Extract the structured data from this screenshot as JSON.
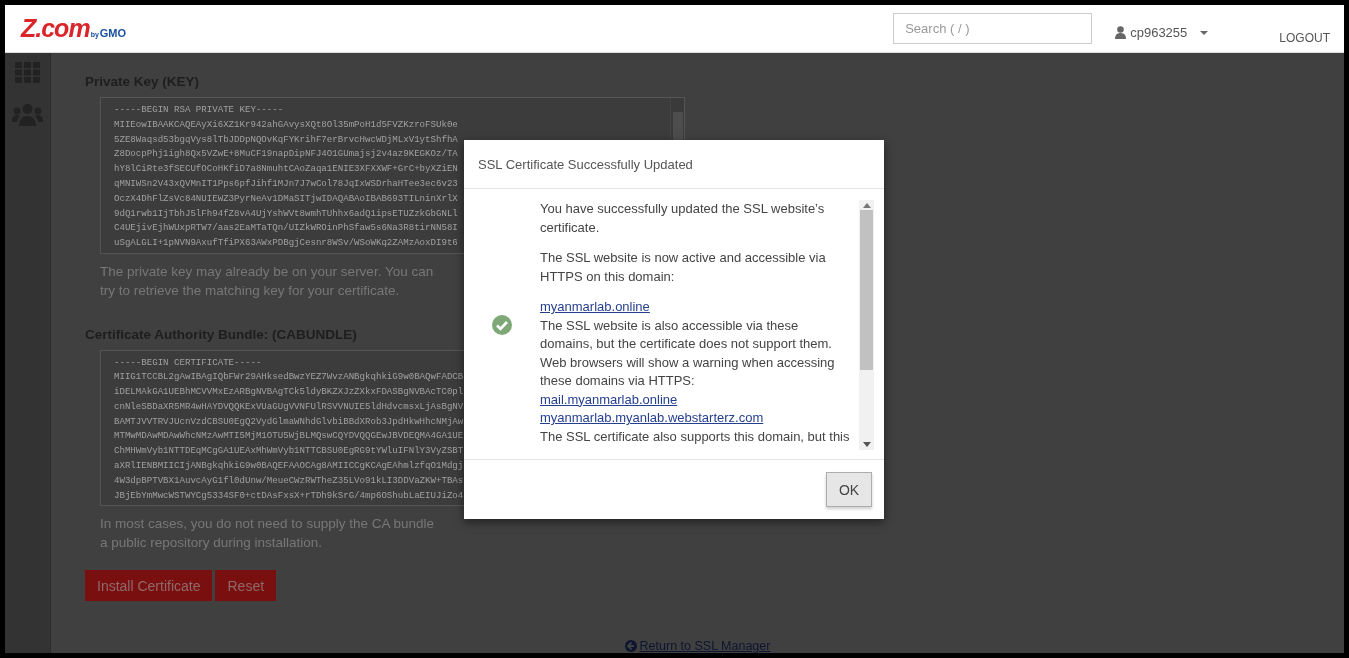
{
  "header": {
    "logo": {
      "brand": "Z.com",
      "by": "by",
      "maker": "GMO"
    },
    "search": {
      "placeholder": "Search ( / )"
    },
    "user": "cp963255",
    "logout": "LOGOUT"
  },
  "sections": [
    {
      "title": "Private Key (KEY)",
      "lines": [
        "-----BEGIN RSA PRIVATE KEY-----",
        "MIIEowIBAAKCAQEAyXi6XZ1Kr942ahGAvysXQt8Ol35mPoH1d5FVZKzroFSUk0e",
        "5ZE8Waqsd53bgqVys8lTbJDDpNQOvKqFYKrihF7erBrvcHwcWDjMLxV1ytShfhA",
        "Z8DocpPhj1igh8Qx5VZwE+8MuCF19napDipNFJ4O1GUmajsj2v4az9KEGKOz/TA",
        "hY8lCiRte3fSECUfOCoHKfiD7a8NmuhtCAoZaqa1ENIE3XFXXWF+GrC+byXZiEN",
        "qMNIWSn2V43xQVMnIT1Pps6pfJihf1MJn7J7wCol78JqIxWSDrhaHTee3ec6v23",
        "OczX4DhFlZsVc84NUIEWZ3PyrNeAv1DMaSITjwIDAQABAoIBAB693TILninXrlX",
        "9dQ1rwb1IjTbhJ5lFh94fZ8vA4UjYshWVt8wmhTUhhx6adQ1ipsETUZzkGbGNLl",
        "C4UEjivEjhWUxpRTW7/aas2EaMTaTQn/UIZkWROinPhSfaw5s6Na3R8tirNN58I",
        "uSgALGLI+1pNVN9AxufTfiPX63AWxPDBgjCesnr8WSv/WSoWKq2ZAMzAoxDI9t6"
      ],
      "help": [
        "The private key may already be on your server. You can",
        "try to retrieve the matching key for your certificate."
      ]
    },
    {
      "title": "Certificate Authority Bundle: (CABUNDLE)",
      "lines": [
        "-----BEGIN CERTIFICATE-----",
        "MIIG1TCCBL2gAwIBAgIQbFWr29AHksedBwzYEZ7WvzANBgkqhkiG9w0BAQwFADCB",
        "iDELMAkGA1UEBhMCVVMxEzARBgNVBAgTCk5ldyBKZXJzZXkxFDASBgNVBAcTC0pl",
        "cnNleSBDaXR5MR4wHAYDVQQKExVUaGUgVVNFUlRSVVNUIE5ldHdvcmsxLjAsBgNV",
        "BAMTJVVTRVJUcnVzdCBSU0EgQ2VydGlmaWNhdGlvbiBBdXRob3JpdHkwHhcNMjAw",
        "MTMwMDAwMDAwWhcNMzAwMTI5MjM1OTU5WjBLMQswCQYDVQQGEwJBVDEQMA4GA1UE",
        "ChMHWmVyb1NTTDEqMCgGA1UEAxMhWmVyb1NTTCBSU0EgRG9tYWluIFNlY3VyZSBT",
        "aXRlIENBMIICIjANBgkqhkiG9w0BAQEFAAOCAg8AMIICCgKCAgEAhmlzfqO1Mdgj",
        "4W3dpBPTVBX1AuvcAyG1fl0dUnw/MeueCWzRWTheZ35LVo91kLI3DDVaZKW+TBAs",
        "JBjEbYmMwcWSTWYCg5334SF0+ctDAsFxsX+rTDh9kSrG/4mp6OShubLaEIUJiZo4"
      ],
      "help": [
        "In most cases, you do not need to supply the CA bundle",
        "a public repository during installation."
      ]
    }
  ],
  "buttons": [
    "Install Certificate",
    "Reset"
  ],
  "return_link": "Return to SSL Manager",
  "modal": {
    "title": "SSL Certificate Successfully Updated",
    "items": [
      {
        "kind": "para",
        "text": "You have successfully updated the SSL website’s certificate."
      },
      {
        "kind": "para",
        "text": "The SSL website is now active and accessible via HTTPS on this domain:"
      },
      {
        "kind": "link",
        "text": "myanmarlab.online"
      },
      {
        "kind": "text",
        "text": "The SSL website is also accessible via these domains, but the certificate does not support them. Web browsers will show a warning when accessing these domains via HTTPS:"
      },
      {
        "kind": "link",
        "text": "mail.myanmarlab.online"
      },
      {
        "kind": "link",
        "text": "myanmarlab.myanlab.webstarterz.com"
      },
      {
        "kind": "text",
        "text": "The SSL certificate also supports this domain, but this"
      }
    ],
    "ok": "OK"
  }
}
